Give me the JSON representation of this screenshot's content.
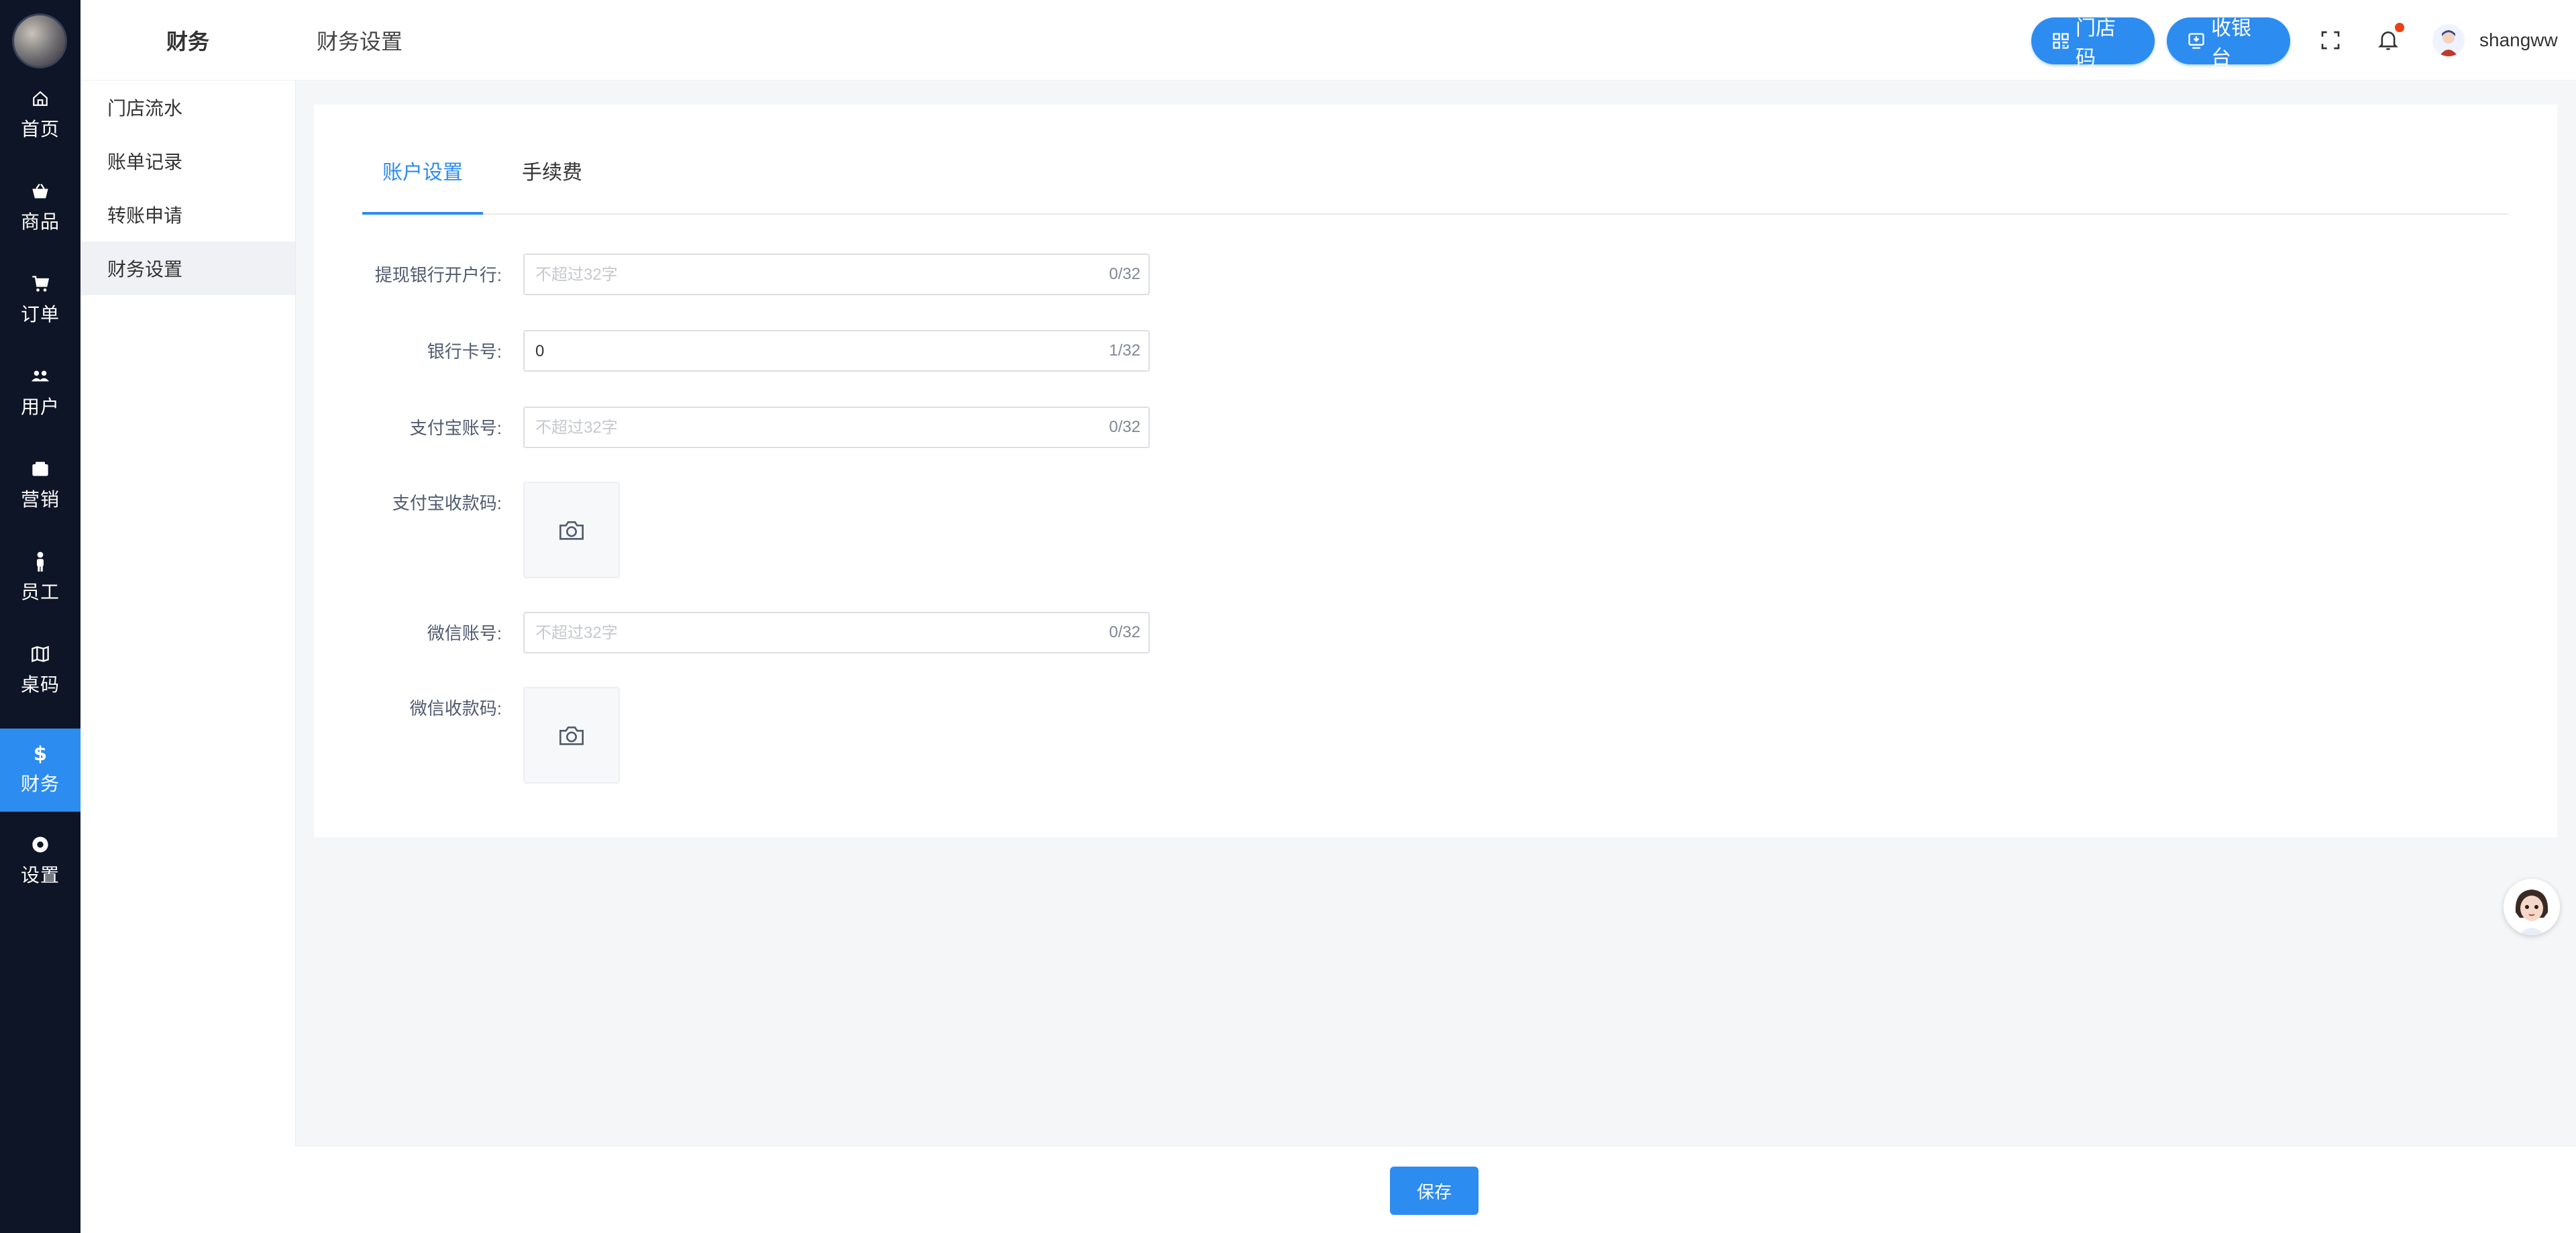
{
  "rail": {
    "items": [
      {
        "label": "首页",
        "icon": "home-icon"
      },
      {
        "label": "商品",
        "icon": "basket-icon"
      },
      {
        "label": "订单",
        "icon": "cart-icon"
      },
      {
        "label": "用户",
        "icon": "users-icon"
      },
      {
        "label": "营销",
        "icon": "box-icon"
      },
      {
        "label": "员工",
        "icon": "person-icon"
      },
      {
        "label": "桌码",
        "icon": "map-icon"
      },
      {
        "label": "财务",
        "icon": "dollar-icon",
        "active": true
      },
      {
        "label": "设置",
        "icon": "gear-icon"
      }
    ]
  },
  "subnav": {
    "title": "财务",
    "items": [
      {
        "label": "门店流水"
      },
      {
        "label": "账单记录"
      },
      {
        "label": "转账申请"
      },
      {
        "label": "财务设置",
        "active": true
      }
    ]
  },
  "header": {
    "breadcrumb": "财务设置",
    "store_code_label": "门店码",
    "cashier_label": "收银台",
    "username": "shangww"
  },
  "tabs": [
    {
      "label": "账户设置",
      "active": true
    },
    {
      "label": "手续费"
    }
  ],
  "form": {
    "bank_name": {
      "label": "提现银行开户行:",
      "value": "",
      "placeholder": "不超过32字",
      "count": "0/32"
    },
    "bank_card": {
      "label": "银行卡号:",
      "value": "0",
      "placeholder": "不超过32字",
      "count": "1/32"
    },
    "alipay_account": {
      "label": "支付宝账号:",
      "value": "",
      "placeholder": "不超过32字",
      "count": "0/32"
    },
    "alipay_qr": {
      "label": "支付宝收款码:"
    },
    "wechat_account": {
      "label": "微信账号:",
      "value": "",
      "placeholder": "不超过32字",
      "count": "0/32"
    },
    "wechat_qr": {
      "label": "微信收款码:"
    }
  },
  "footer": {
    "save_label": "保存"
  },
  "colors": {
    "accent": "#2d8cf0",
    "rail_bg": "#0d1526",
    "notify_dot": "#ed4014"
  }
}
